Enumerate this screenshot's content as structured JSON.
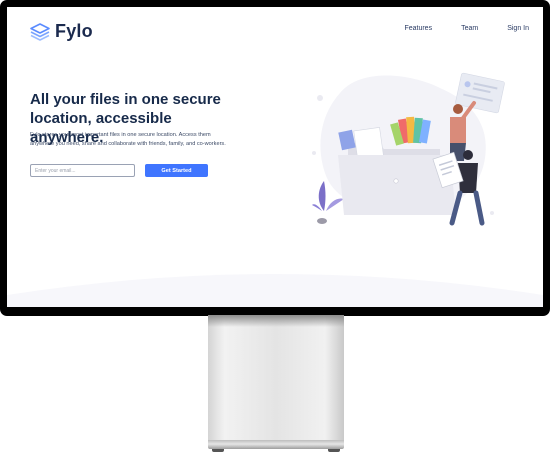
{
  "brand": {
    "name": "Fylo",
    "logo_icon": "stacked-layers-icon",
    "accent_color": "#3f75ff",
    "text_color": "#172a4a"
  },
  "nav": {
    "items": [
      {
        "label": "Features"
      },
      {
        "label": "Team"
      },
      {
        "label": "Sign In"
      }
    ]
  },
  "hero": {
    "title": "All your files in one secure location, accessible anywhere.",
    "description": "Fylo stores your most important files in one secure location. Access them anywhere you need, share and collaborate with friends, family, and co-workers.",
    "email_placeholder": "Enter your email...",
    "email_value": "",
    "cta_label": "Get Started",
    "illustration": "file-sharing-illustration"
  },
  "device": {
    "type": "desktop-monitor",
    "frame_color": "#000000",
    "stand_color": "#e4e4e4"
  }
}
